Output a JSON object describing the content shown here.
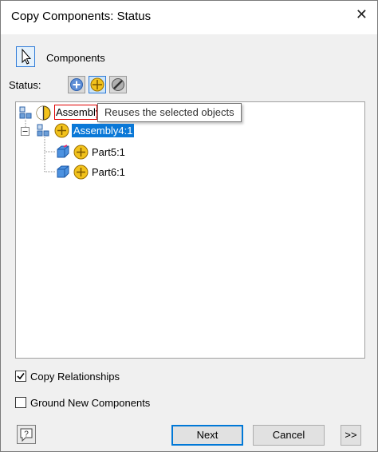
{
  "window": {
    "title": "Copy Components: Status",
    "close_glyph": "✕"
  },
  "components": {
    "label": "Components",
    "icon": "select-arrow-icon"
  },
  "status": {
    "label": "Status:",
    "buttons": [
      "add-status-icon",
      "reuse-status-icon",
      "exclude-status-icon"
    ]
  },
  "tree": {
    "root": {
      "label_partial": "Assembly",
      "tooltip": "Reuses the selected objects"
    },
    "assembly": {
      "label": "Assembly4:1",
      "expander": "−"
    },
    "parts": [
      {
        "label": "Part5:1"
      },
      {
        "label": "Part6:1"
      }
    ]
  },
  "options": {
    "copy_relationships": {
      "label": "Copy Relationships",
      "checked": true
    },
    "ground_new_components": {
      "label": "Ground New Components",
      "checked": false
    }
  },
  "footer": {
    "next_label": "Next",
    "cancel_label": "Cancel",
    "expand_label": ">>"
  },
  "colors": {
    "selection": "#0a78d7",
    "reuse_yellow": "#f2c21c",
    "primary_border": "#0078d7"
  }
}
